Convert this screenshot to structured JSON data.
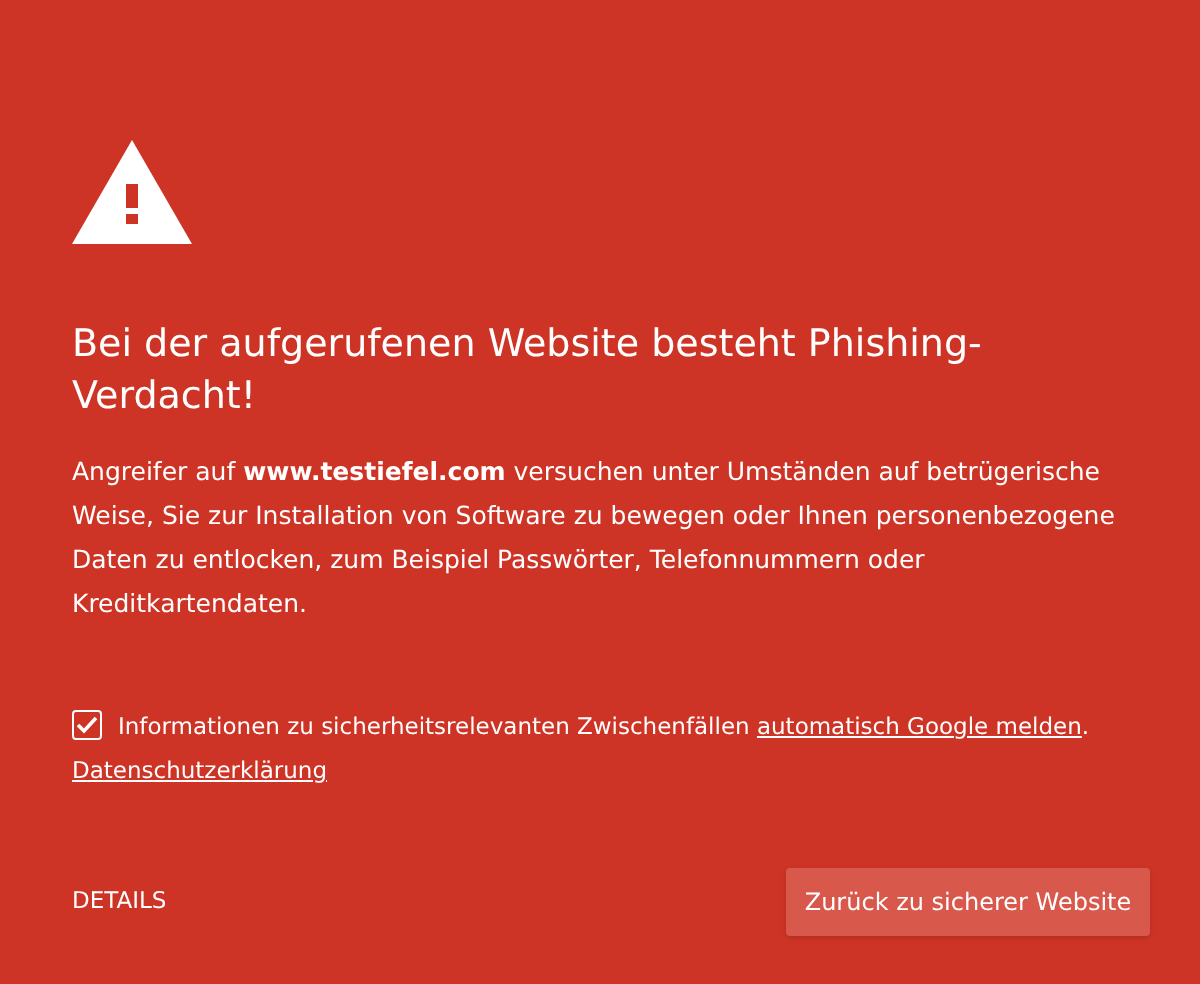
{
  "heading": "Bei der aufgerufenen Website besteht Phishing-Verdacht!",
  "description": "Angreifer auf **www.testiefel.com** versuchen unter Umständen auf betrügerische Weise, Sie zur Installation von Software zu bewegen oder Ihnen personenbezogene Daten zu entlocken, zum Beispiel Passwörter, Telefonnummern oder Kreditkartendaten.",
  "report": {
    "checked": true,
    "text": "Informationen zu sicherheitsrelevanten Zwischenfällen ",
    "link": "automatisch Google melden",
    "text_after": "."
  },
  "privacy_link": "Datenschutzerklärung",
  "details_link": "DETAILS",
  "back_button": "Zurück zu sicherer Website"
}
